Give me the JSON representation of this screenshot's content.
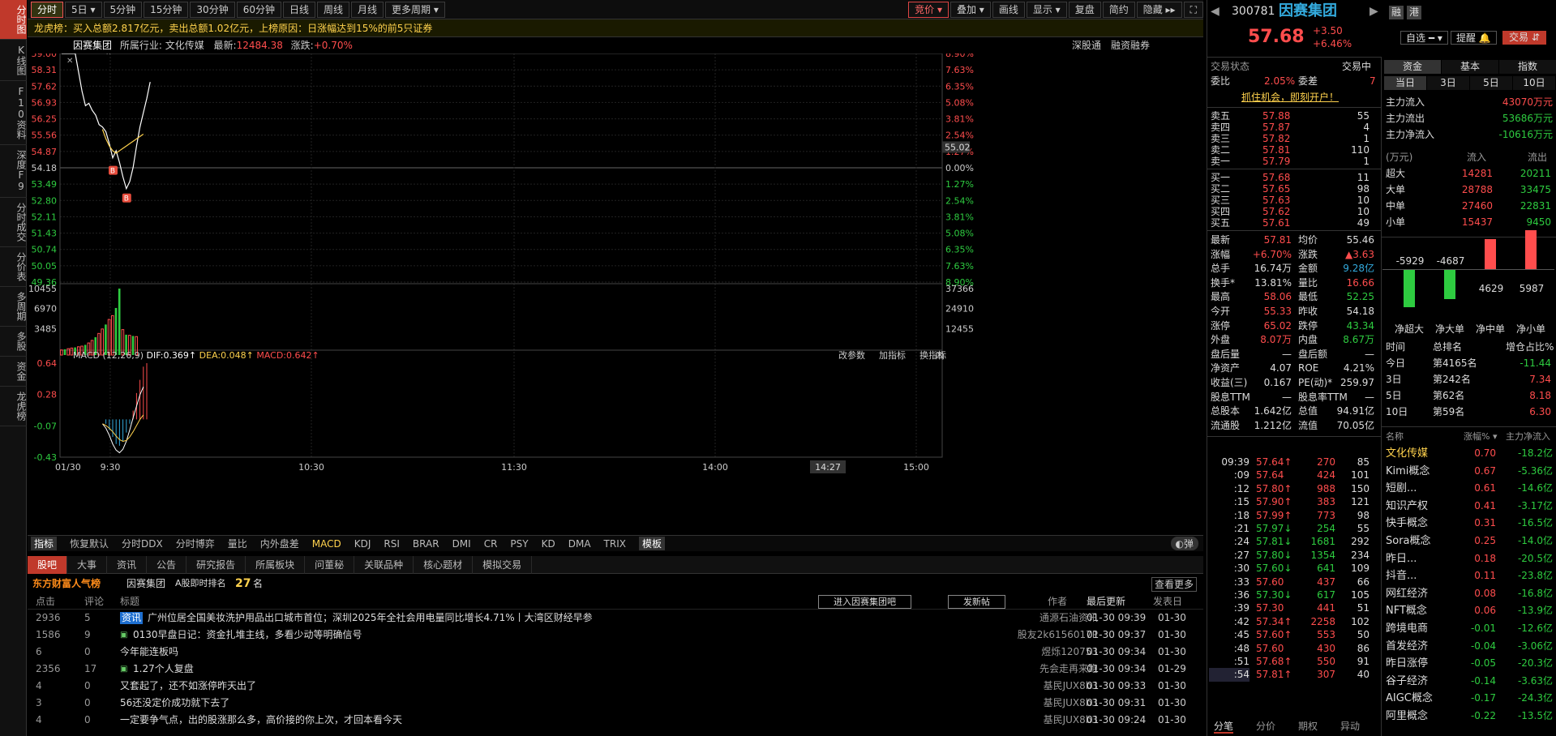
{
  "vtabs": [
    "分时图",
    "K线图",
    "F10资料",
    "深度F9",
    "分时成交",
    "分价表",
    "多周期",
    "多股",
    "资金",
    "龙虎榜"
  ],
  "toolbar": {
    "left": [
      "分时",
      "5日",
      "5分钟",
      "15分钟",
      "30分钟",
      "60分钟",
      "日线",
      "周线",
      "月线",
      "更多周期"
    ],
    "right": [
      "竞价",
      "叠加",
      "画线",
      "显示",
      "复盘",
      "简约",
      "隐藏"
    ]
  },
  "dragon": "龙虎榜：买入总额2.817亿元，卖出总额1.02亿元，上榜原因：日涨幅达到15%的前5只证券",
  "chartinfo": {
    "name": "因赛集团",
    "industry": "所属行业: 文化传媒",
    "latest_label": "最新:",
    "latest": "12484.38",
    "change_label": "涨跌:",
    "change": "+0.70%",
    "r1": "深股通",
    "r2": "融资融券"
  },
  "chart_data": {
    "type": "line",
    "price_ticks": [
      "59.00",
      "58.31",
      "57.62",
      "56.93",
      "56.25",
      "55.56",
      "54.87",
      "54.18",
      "53.49",
      "52.80",
      "52.11",
      "51.43",
      "50.74",
      "50.05",
      "49.36"
    ],
    "pct_ticks": [
      "8.90%",
      "7.63%",
      "6.35%",
      "5.08%",
      "3.81%",
      "2.54%",
      "1.27%",
      "0.00%",
      "1.27%",
      "2.54%",
      "3.81%",
      "5.08%",
      "6.35%",
      "7.63%",
      "8.90%"
    ],
    "vol_ticks": [
      "10455",
      "6970",
      "3485"
    ],
    "vol_ticks_r": [
      "37366",
      "24910",
      "12455"
    ],
    "macd_ticks": [
      "0.64",
      "0.28",
      "-0.07",
      "-0.43"
    ],
    "time_ticks": [
      "01/30",
      "9:30",
      "10:30",
      "11:30",
      "14:00",
      "15:00"
    ],
    "cursor_time": "14:27",
    "cursor_price": "55.02",
    "prev_close": 54.18,
    "price": [
      59.0,
      59.0,
      59.0,
      59.0,
      59.0,
      58.2,
      57.4,
      56.8,
      56.9,
      56.6,
      56.4,
      56.0,
      55.9,
      55.7,
      55.2,
      54.6,
      54.9,
      54.4,
      53.8,
      53.3,
      53.6,
      54.2,
      55.1,
      55.9,
      56.5,
      57.1,
      57.8
    ],
    "avg": [
      null,
      null,
      null,
      null,
      null,
      null,
      null,
      null,
      null,
      null,
      null,
      null,
      55.8,
      55.4,
      55.1,
      54.9,
      54.8,
      54.9,
      55.0,
      55.1,
      55.2,
      55.3,
      55.4,
      55.5,
      55.6
    ],
    "volume": [
      800,
      900,
      1000,
      1100,
      1200,
      1300,
      1400,
      1600,
      1900,
      2300,
      2800,
      3400,
      4100,
      4800,
      5600,
      6200,
      7400,
      10455,
      4000,
      3200,
      3100,
      3000,
      2900
    ],
    "macd_label": "MACD (12,26,9)",
    "dif": "DIF:0.369↑",
    "dea": "DEA:0.048↑",
    "macd": "MACD:0.642↑",
    "macd_btns": [
      "改参数",
      "加指标",
      "换指标"
    ],
    "markers": [
      "B",
      "B"
    ]
  },
  "indicators": [
    "指标",
    "恢复默认",
    "分时DDX",
    "分时博弈",
    "量比",
    "内外盘差",
    "MACD",
    "KDJ",
    "RSI",
    "BRAR",
    "DMI",
    "CR",
    "PSY",
    "KD",
    "DMA",
    "TRIX",
    "模板"
  ],
  "bottom_tabs": [
    "股吧",
    "大事",
    "资讯",
    "公告",
    "研究报告",
    "所属板块",
    "问董秘",
    "关联品种",
    "核心题材",
    "模拟交易"
  ],
  "bhead": {
    "brand": "东方财富人气榜",
    "stock": "因赛集团",
    "rank_label": "A股即时排名",
    "rank": "27",
    "rank_unit": "名",
    "more": "查看更多"
  },
  "bcols": {
    "c1": "点击",
    "c2": "评论",
    "c3": "标题",
    "btn1": "进入因赛集团吧",
    "btn2": "发新帖",
    "c4": "作者",
    "c5": "最后更新",
    "c6": "发表日"
  },
  "posts": [
    {
      "clicks": "2936",
      "comments": "5",
      "tag": "资讯",
      "title": "广州位居全国美妆洗护用品出口城市首位；深圳2025年全社会用电量同比增长4.71%丨大湾区财经早参",
      "author": "通源石油资讯",
      "updated": "01-30 09:39",
      "date": "01-30"
    },
    {
      "clicks": "1586",
      "comments": "9",
      "tag": "",
      "title": "0130早盘日记：资金扎堆主线，多看少动等明确信号",
      "author": "股友2k6156017P",
      "updated": "01-30 09:37",
      "date": "01-30"
    },
    {
      "clicks": "6",
      "comments": "0",
      "tag": "",
      "title": "今年能连板吗",
      "author": "煜烁120753",
      "updated": "01-30 09:34",
      "date": "01-30"
    },
    {
      "clicks": "2356",
      "comments": "17",
      "tag": "",
      "title": "1.27个人复盘",
      "author": "先会走再来跑",
      "updated": "01-30 09:34",
      "date": "01-29"
    },
    {
      "clicks": "4",
      "comments": "0",
      "tag": "",
      "title": "又套起了，还不如涨停昨天出了",
      "author": "基民JUX8b3",
      "updated": "01-30 09:33",
      "date": "01-30"
    },
    {
      "clicks": "3",
      "comments": "0",
      "tag": "",
      "title": "56还没定价成功就下去了",
      "author": "基民JUX8b3",
      "updated": "01-30 09:31",
      "date": "01-30"
    },
    {
      "clicks": "4",
      "comments": "0",
      "tag": "",
      "title": "一定要争气点，出的股涨那么多，高价接的你上次，才回本看今天",
      "author": "基民JUX8b3",
      "updated": "01-30 09:24",
      "date": "01-30"
    }
  ],
  "rp": {
    "code": "300781",
    "name": "因赛集团",
    "tag1": "融",
    "tag2": "港",
    "price": "57.68",
    "chg": "+3.50",
    "pct": "+6.46%",
    "btn_watch": "自选",
    "btn_alert": "提醒",
    "btn_trade": "交易",
    "status_label": "交易状态",
    "status": "交易中",
    "wb_label": "委比",
    "wb": "2.05%",
    "wc_label": "委差",
    "wc": "7",
    "ad": "抓住机会，即刻开户！",
    "asks": [
      [
        "卖五",
        "57.88",
        "55"
      ],
      [
        "卖四",
        "57.87",
        "4"
      ],
      [
        "卖三",
        "57.82",
        "1"
      ],
      [
        "卖二",
        "57.81",
        "110"
      ],
      [
        "卖一",
        "57.79",
        "1"
      ]
    ],
    "bids": [
      [
        "买一",
        "57.68",
        "11"
      ],
      [
        "买二",
        "57.65",
        "98"
      ],
      [
        "买三",
        "57.63",
        "10"
      ],
      [
        "买四",
        "57.62",
        "10"
      ],
      [
        "买五",
        "57.61",
        "49"
      ]
    ],
    "stats": [
      [
        "最新",
        "57.81",
        "均价",
        "55.46"
      ],
      [
        "涨幅",
        "+6.70%",
        "涨跌",
        "▲3.63"
      ],
      [
        "总手",
        "16.74万",
        "金额",
        "9.28亿"
      ],
      [
        "换手*",
        "13.81%",
        "量比",
        "16.66"
      ],
      [
        "最高",
        "58.06",
        "最低",
        "52.25"
      ],
      [
        "今开",
        "55.33",
        "昨收",
        "54.18"
      ],
      [
        "涨停",
        "65.02",
        "跌停",
        "43.34"
      ],
      [
        "外盘",
        "8.07万",
        "内盘",
        "8.67万"
      ],
      [
        "盘后量",
        "—",
        "盘后额",
        "—"
      ],
      [
        "净资产",
        "4.07",
        "ROE",
        "4.21%"
      ],
      [
        "收益(三)",
        "0.167",
        "PE(动)*",
        "259.97"
      ],
      [
        "股息TTM",
        "—",
        "股息率TTM",
        "—"
      ],
      [
        "总股本",
        "1.642亿",
        "总值",
        "94.91亿"
      ],
      [
        "流通股",
        "1.212亿",
        "流值",
        "70.05亿"
      ]
    ],
    "ticks": [
      [
        "09:39",
        "57.64↑",
        "270",
        "85"
      ],
      [
        ":09",
        "57.64",
        "424",
        "101"
      ],
      [
        ":12",
        "57.80↑",
        "988",
        "150"
      ],
      [
        ":15",
        "57.90↑",
        "383",
        "121"
      ],
      [
        ":18",
        "57.99↑",
        "773",
        "98"
      ],
      [
        ":21",
        "57.97↓",
        "254",
        "55"
      ],
      [
        ":24",
        "57.81↓",
        "1681",
        "292"
      ],
      [
        ":27",
        "57.80↓",
        "1354",
        "234"
      ],
      [
        ":30",
        "57.60↓",
        "641",
        "109"
      ],
      [
        ":33",
        "57.60",
        "437",
        "66"
      ],
      [
        ":36",
        "57.30↓",
        "617",
        "105"
      ],
      [
        ":39",
        "57.30",
        "441",
        "51"
      ],
      [
        ":42",
        "57.34↑",
        "2258",
        "102"
      ],
      [
        ":45",
        "57.60↑",
        "553",
        "50"
      ],
      [
        ":48",
        "57.60",
        "430",
        "86"
      ],
      [
        ":51",
        "57.68↑",
        "550",
        "91"
      ],
      [
        ":54",
        "57.81↑",
        "307",
        "40"
      ]
    ],
    "tick_tabs": [
      "分笔",
      "分价",
      "期权",
      "异动"
    ],
    "fund_tabs": [
      "资金",
      "基本",
      "指数"
    ],
    "day_tabs": [
      "当日",
      "3日",
      "5日",
      "10日"
    ],
    "flows": [
      [
        "主力流入",
        "43070万元"
      ],
      [
        "主力流出",
        "53686万元"
      ],
      [
        "主力净流入",
        "-10616万元"
      ]
    ],
    "flow_head": [
      "(万元)",
      "流入",
      "流出"
    ],
    "flow_rows": [
      [
        "超大",
        "14281",
        "20211"
      ],
      [
        "大单",
        "28788",
        "33475"
      ],
      [
        "中单",
        "27460",
        "22831"
      ],
      [
        "小单",
        "15437",
        "9450"
      ]
    ],
    "bars": [
      {
        "label": "净超大",
        "v": -5929
      },
      {
        "label": "净大单",
        "v": -4687
      },
      {
        "label": "净中单",
        "v": 4629
      },
      {
        "label": "净小单",
        "v": 5987
      }
    ],
    "rank_head": [
      "时间",
      "总排名",
      "增仓占比%"
    ],
    "ranks": [
      [
        "今日",
        "第4165名",
        "-11.44"
      ],
      [
        "3日",
        "第242名",
        "7.34"
      ],
      [
        "5日",
        "第62名",
        "8.18"
      ],
      [
        "10日",
        "第59名",
        "6.30"
      ]
    ],
    "concept_head": [
      "名称",
      "涨幅%",
      "主力净流入"
    ],
    "concepts": [
      [
        "文化传媒",
        "0.70",
        "-18.2亿"
      ],
      [
        "Kimi概念",
        "0.67",
        "-5.36亿"
      ],
      [
        "短剧...",
        "0.61",
        "-14.6亿"
      ],
      [
        "知识产权",
        "0.41",
        "-3.17亿"
      ],
      [
        "快手概念",
        "0.31",
        "-16.5亿"
      ],
      [
        "Sora概念",
        "0.25",
        "-14.0亿"
      ],
      [
        "昨日...",
        "0.18",
        "-20.5亿"
      ],
      [
        "抖音...",
        "0.11",
        "-23.8亿"
      ],
      [
        "网红经济",
        "0.08",
        "-16.8亿"
      ],
      [
        "NFT概念",
        "0.06",
        "-13.9亿"
      ],
      [
        "跨境电商",
        "-0.01",
        "-12.6亿"
      ],
      [
        "首发经济",
        "-0.04",
        "-3.06亿"
      ],
      [
        "昨日涨停",
        "-0.05",
        "-20.3亿"
      ],
      [
        "谷子经济",
        "-0.14",
        "-3.63亿"
      ],
      [
        "AIGC概念",
        "-0.17",
        "-24.3亿"
      ],
      [
        "阿里概念",
        "-0.22",
        "-13.5亿"
      ]
    ]
  },
  "colors": {
    "up": "#ff4d4d",
    "down": "#2ecc40",
    "avg": "#ffd24d",
    "price_line": "#ffffff",
    "accent": "#c0392b"
  }
}
